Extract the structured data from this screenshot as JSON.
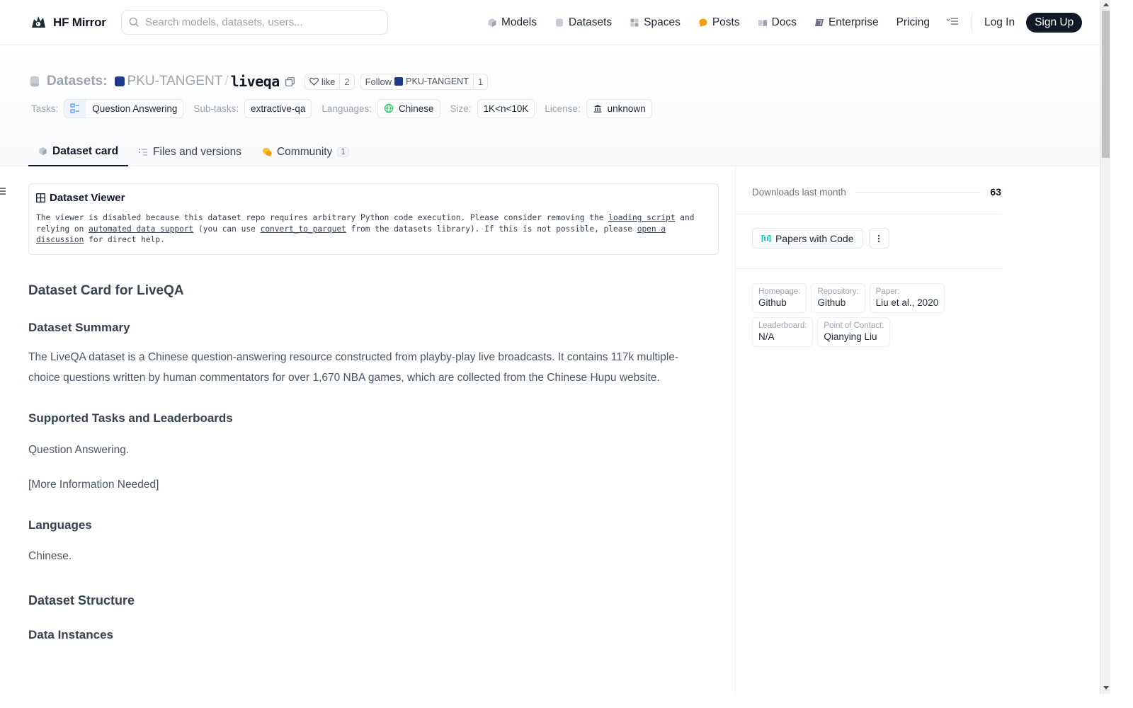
{
  "nav": {
    "brand": "HF Mirror",
    "search_placeholder": "Search models, datasets, users...",
    "links": [
      "Models",
      "Datasets",
      "Spaces",
      "Posts",
      "Docs",
      "Enterprise",
      "Pricing"
    ],
    "login": "Log In",
    "signup": "Sign Up"
  },
  "header": {
    "section": "Datasets:",
    "org": "PKU-TANGENT",
    "slash": "/",
    "repo": "liveqa",
    "like_label": "like",
    "like_count": "2",
    "follow_label": "Follow",
    "follow_org": "PKU-TANGENT",
    "follow_count": "1"
  },
  "tags": {
    "tasks_label": "Tasks:",
    "task": "Question Answering",
    "subtasks_label": "Sub-tasks:",
    "subtask": "extractive-qa",
    "languages_label": "Languages:",
    "language": "Chinese",
    "size_label": "Size:",
    "size": "1K<n<10K",
    "license_label": "License:",
    "license": "unknown"
  },
  "tabs": {
    "card": "Dataset card",
    "files": "Files and versions",
    "community": "Community",
    "community_count": "1"
  },
  "viewer": {
    "title": "Dataset Viewer",
    "msg_1": "The viewer is disabled because this dataset repo requires arbitrary Python code execution. Please consider removing the ",
    "link_1": "loading script",
    "msg_2": " and relying on ",
    "link_2": "automated data support",
    "msg_3": " (you can use ",
    "link_3": "convert_to_parquet",
    "msg_4": " from the datasets library). If this is not possible, please ",
    "link_4": "open a discussion",
    "msg_5": " for direct help."
  },
  "card": {
    "h_title": "Dataset Card for LiveQA",
    "h_summary": "Dataset Summary",
    "summary": "The LiveQA dataset is a Chinese question-answering resource constructed from playby-play live broadcasts. It contains 117k multiple-choice questions written by human commentators for over 1,670 NBA games, which are collected from the Chinese Hupu website.",
    "h_tasks": "Supported Tasks and Leaderboards",
    "tasks_text": "Question Answering.",
    "tasks_more": "[More Information Needed]",
    "h_languages": "Languages",
    "languages_text": "Chinese.",
    "h_structure": "Dataset Structure",
    "h_instances": "Data Instances"
  },
  "sidebar": {
    "downloads_label": "Downloads last month",
    "downloads_value": "63",
    "pwc_label": "Papers with Code",
    "meta": [
      {
        "k": "Homepage:",
        "v": "Github"
      },
      {
        "k": "Repository:",
        "v": "Github"
      },
      {
        "k": "Paper:",
        "v": "Liu et al., 2020"
      },
      {
        "k": "Leaderboard:",
        "v": "N/A"
      },
      {
        "k": "Point of Contact:",
        "v": "Qianying Liu"
      }
    ]
  },
  "colors": {
    "primary_dark": "#111827",
    "muted": "#9ca3af",
    "posts_accent": "#f59e0b",
    "pwc_accent": "#21cbce"
  }
}
